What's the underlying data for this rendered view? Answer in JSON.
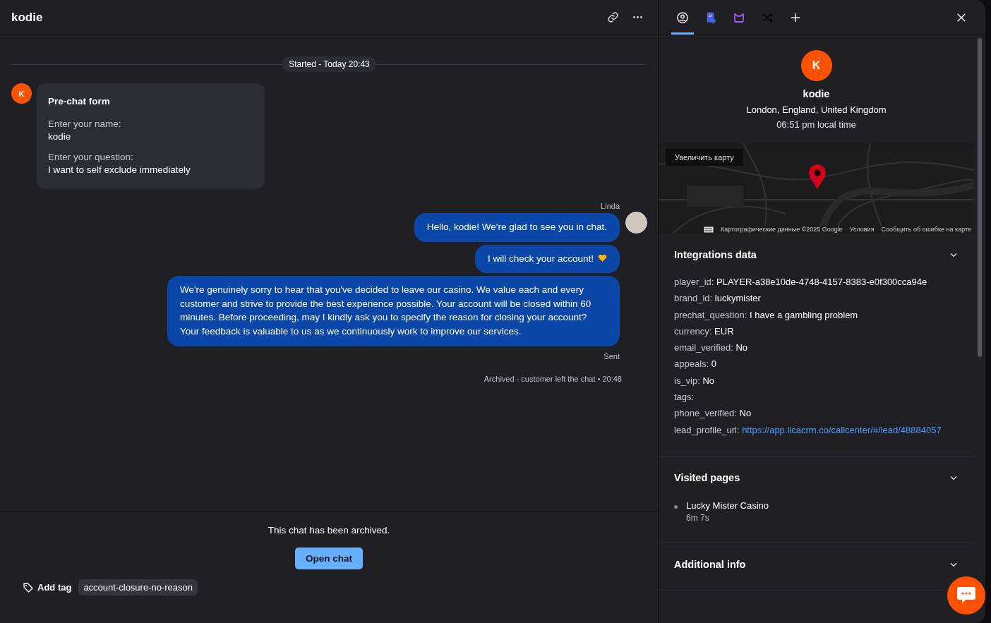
{
  "chat": {
    "title": "kodie",
    "started": "Started - Today 20:43",
    "customer_initial": "K",
    "prechat": {
      "title": "Pre-chat form",
      "fields": [
        {
          "label": "Enter your name:",
          "value": "kodie"
        },
        {
          "label": "Enter your question:",
          "value": "I want to self exclude immediately"
        }
      ]
    },
    "agent_name": "Linda",
    "messages": [
      {
        "text": "Hello, kodie! We're glad to see you in chat.",
        "heart": false
      },
      {
        "text": "I will check your account!",
        "heart": true
      },
      {
        "text": "We're genuinely sorry to hear that you've decided to leave our casino. We value each and every customer and strive to provide the best experience possible. Your account will be closed within 60 minutes. Before proceeding, may I kindly ask you to specify the reason for closing your account? Your feedback is valuable to us as we continuously work to improve our services.",
        "heart": false
      }
    ],
    "sent_status": "Sent",
    "archived_note": "Archived - customer left the chat • 20:48",
    "archived_banner": "This chat has been archived.",
    "open_chat_button": "Open chat",
    "add_tag": "Add tag",
    "tags": [
      "account-closure-no-reason"
    ]
  },
  "panel": {
    "tabs": [
      {
        "kind": "profile",
        "selected": true
      },
      {
        "kind": "notes",
        "selected": false
      },
      {
        "kind": "app",
        "selected": false
      },
      {
        "kind": "shuffle",
        "selected": false
      },
      {
        "kind": "add",
        "selected": false
      }
    ],
    "visitor": {
      "initial": "K",
      "name": "kodie",
      "location": "London, England, United Kingdom",
      "local_time": "06:51 pm local time"
    },
    "map": {
      "enlarge_button": "Увеличить карту",
      "attribution": "Картографические данные ©2025 Google",
      "terms": "Условия",
      "report": "Сообщить об ошибке на карте"
    },
    "sections": [
      {
        "title": "Integrations data",
        "kind": "fields",
        "fields": [
          {
            "key": "player_id:",
            "value": "PLAYER-a38e10de-4748-4157-8383-e0f300cca94e",
            "kind": "text"
          },
          {
            "key": "brand_id:",
            "value": "luckymister",
            "kind": "text"
          },
          {
            "key": "prechat_question:",
            "value": "I have a gambling problem",
            "kind": "text"
          },
          {
            "key": "currency:",
            "value": "EUR",
            "kind": "text"
          },
          {
            "key": "email_verified:",
            "value": "No",
            "kind": "text"
          },
          {
            "key": "appeals:",
            "value": "0",
            "kind": "text"
          },
          {
            "key": "is_vip:",
            "value": "No",
            "kind": "text"
          },
          {
            "key": "tags:",
            "kind": "text"
          },
          {
            "key": "phone_verified:",
            "value": "No",
            "kind": "text"
          },
          {
            "key": "lead_profile_url:",
            "value": "https://app.licacrm.co/callcenter/#/lead/48884057",
            "kind": "link"
          }
        ]
      },
      {
        "title": "Visited pages",
        "kind": "pages",
        "pages": [
          {
            "title": "Lucky Mister Casino",
            "duration": "6m 7s"
          }
        ]
      },
      {
        "title": "Additional info",
        "kind": "empty"
      }
    ]
  }
}
